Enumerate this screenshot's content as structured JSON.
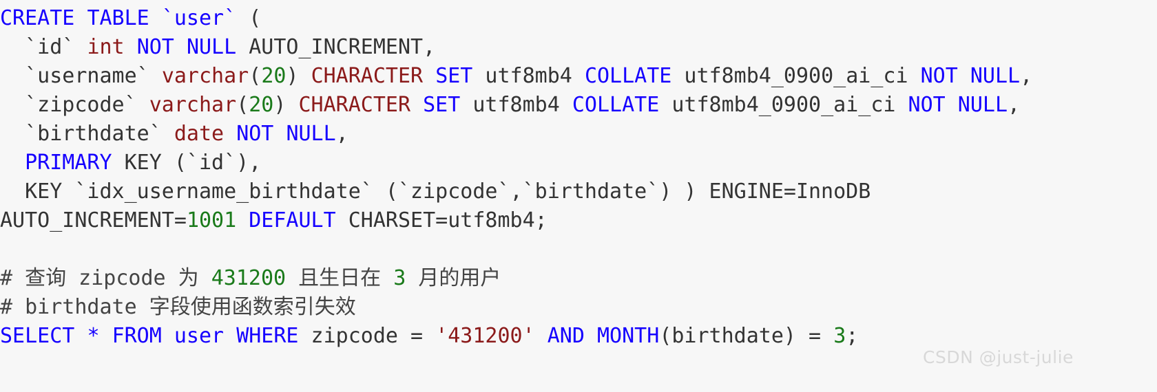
{
  "editor": {
    "background_color": "#f7f7f7",
    "language": "sql",
    "colors": {
      "keyword": "#1500ff",
      "type": "#8b1a1a",
      "number": "#1a7a1a",
      "string": "#8b1a1a",
      "identifier": "#333333",
      "comment": "#444444",
      "watermark": "#d8d8d8"
    }
  },
  "code": {
    "plain_text": "CREATE TABLE `user` (\n  `id` int NOT NULL AUTO_INCREMENT,\n  `username` varchar(20) CHARACTER SET utf8mb4 COLLATE utf8mb4_0900_ai_ci NOT NULL,\n  `zipcode` varchar(20) CHARACTER SET utf8mb4 COLLATE utf8mb4_0900_ai_ci NOT NULL,\n  `birthdate` date NOT NULL,\n  PRIMARY KEY (`id`),\n  KEY `idx_username_birthdate` (`zipcode`,`birthdate`) ) ENGINE=InnoDB AUTO_INCREMENT=1001 DEFAULT CHARSET=utf8mb4;\n\n# 查询 zipcode 为 431200 且生日在 3 月的用户\n# birthdate 字段使用函数索引失效\nSELECT * FROM user WHERE zipcode = '431200' AND MONTH(birthdate) = 3;",
    "lines": [
      {
        "index": 1,
        "tokens": [
          {
            "t": "CREATE",
            "c": "kw"
          },
          {
            "t": " ",
            "c": "id"
          },
          {
            "t": "TABLE",
            "c": "kw"
          },
          {
            "t": " ",
            "c": "id"
          },
          {
            "t": "`user`",
            "c": "kw"
          },
          {
            "t": " (",
            "c": "id"
          }
        ]
      },
      {
        "index": 2,
        "tokens": [
          {
            "t": "  `id` ",
            "c": "id"
          },
          {
            "t": "int",
            "c": "typ"
          },
          {
            "t": " ",
            "c": "id"
          },
          {
            "t": "NOT",
            "c": "kw"
          },
          {
            "t": " ",
            "c": "id"
          },
          {
            "t": "NULL",
            "c": "kw"
          },
          {
            "t": " AUTO_INCREMENT,",
            "c": "id"
          }
        ]
      },
      {
        "index": 3,
        "tokens": [
          {
            "t": "  `username` ",
            "c": "id"
          },
          {
            "t": "varchar",
            "c": "typ"
          },
          {
            "t": "(",
            "c": "id"
          },
          {
            "t": "20",
            "c": "num"
          },
          {
            "t": ") ",
            "c": "id"
          },
          {
            "t": "CHARACTER",
            "c": "typ"
          },
          {
            "t": " ",
            "c": "id"
          },
          {
            "t": "SET",
            "c": "kw"
          },
          {
            "t": " utf8mb4 ",
            "c": "id"
          },
          {
            "t": "COLLATE",
            "c": "kw"
          },
          {
            "t": " utf8mb4_0900_ai_ci ",
            "c": "id"
          },
          {
            "t": "NOT",
            "c": "kw"
          },
          {
            "t": " ",
            "c": "id"
          },
          {
            "t": "NULL",
            "c": "kw"
          },
          {
            "t": ",",
            "c": "id"
          }
        ]
      },
      {
        "index": 4,
        "tokens": [
          {
            "t": "  `zipcode` ",
            "c": "id"
          },
          {
            "t": "varchar",
            "c": "typ"
          },
          {
            "t": "(",
            "c": "id"
          },
          {
            "t": "20",
            "c": "num"
          },
          {
            "t": ") ",
            "c": "id"
          },
          {
            "t": "CHARACTER",
            "c": "typ"
          },
          {
            "t": " ",
            "c": "id"
          },
          {
            "t": "SET",
            "c": "kw"
          },
          {
            "t": " utf8mb4 ",
            "c": "id"
          },
          {
            "t": "COLLATE",
            "c": "kw"
          },
          {
            "t": " utf8mb4_0900_ai_ci ",
            "c": "id"
          },
          {
            "t": "NOT",
            "c": "kw"
          },
          {
            "t": " ",
            "c": "id"
          },
          {
            "t": "NULL",
            "c": "kw"
          },
          {
            "t": ",",
            "c": "id"
          }
        ]
      },
      {
        "index": 5,
        "tokens": [
          {
            "t": "  `birthdate` ",
            "c": "id"
          },
          {
            "t": "date",
            "c": "typ"
          },
          {
            "t": " ",
            "c": "id"
          },
          {
            "t": "NOT",
            "c": "kw"
          },
          {
            "t": " ",
            "c": "id"
          },
          {
            "t": "NULL",
            "c": "kw"
          },
          {
            "t": ",",
            "c": "id"
          }
        ]
      },
      {
        "index": 6,
        "tokens": [
          {
            "t": "  ",
            "c": "id"
          },
          {
            "t": "PRIMARY",
            "c": "kw"
          },
          {
            "t": " KEY (`id`),",
            "c": "id"
          }
        ]
      },
      {
        "index": 7,
        "tokens": [
          {
            "t": "  KEY `idx_username_birthdate` (`zipcode`,`birthdate`) ) ENGINE=InnoDB",
            "c": "id"
          }
        ]
      },
      {
        "index": 8,
        "tokens": [
          {
            "t": "AUTO_INCREMENT=",
            "c": "id"
          },
          {
            "t": "1001",
            "c": "num"
          },
          {
            "t": " ",
            "c": "id"
          },
          {
            "t": "DEFAULT",
            "c": "kw"
          },
          {
            "t": " CHARSET=utf8mb4;",
            "c": "id"
          }
        ]
      },
      {
        "index": 9,
        "tokens": []
      },
      {
        "index": 10,
        "tokens": [
          {
            "t": "# 查询 zipcode 为 ",
            "c": "cmt"
          },
          {
            "t": "431200",
            "c": "cmtnum"
          },
          {
            "t": " 且生日在 ",
            "c": "cmt"
          },
          {
            "t": "3",
            "c": "cmtnum"
          },
          {
            "t": " 月的用户",
            "c": "cmt"
          }
        ]
      },
      {
        "index": 11,
        "tokens": [
          {
            "t": "# birthdate 字段使用函数索引失效",
            "c": "cmt"
          }
        ]
      },
      {
        "index": 12,
        "tokens": [
          {
            "t": "SELECT",
            "c": "kw"
          },
          {
            "t": " ",
            "c": "id"
          },
          {
            "t": "*",
            "c": "kw"
          },
          {
            "t": " ",
            "c": "id"
          },
          {
            "t": "FROM",
            "c": "kw"
          },
          {
            "t": " ",
            "c": "id"
          },
          {
            "t": "user",
            "c": "kw"
          },
          {
            "t": " ",
            "c": "id"
          },
          {
            "t": "WHERE",
            "c": "kw"
          },
          {
            "t": " zipcode = ",
            "c": "id"
          },
          {
            "t": "'431200'",
            "c": "str"
          },
          {
            "t": " ",
            "c": "id"
          },
          {
            "t": "AND",
            "c": "kw"
          },
          {
            "t": " ",
            "c": "id"
          },
          {
            "t": "MONTH",
            "c": "fn"
          },
          {
            "t": "(birthdate) = ",
            "c": "id"
          },
          {
            "t": "3",
            "c": "num"
          },
          {
            "t": ";",
            "c": "id"
          }
        ]
      }
    ]
  },
  "watermark": {
    "text": "CSDN @just-julie"
  }
}
